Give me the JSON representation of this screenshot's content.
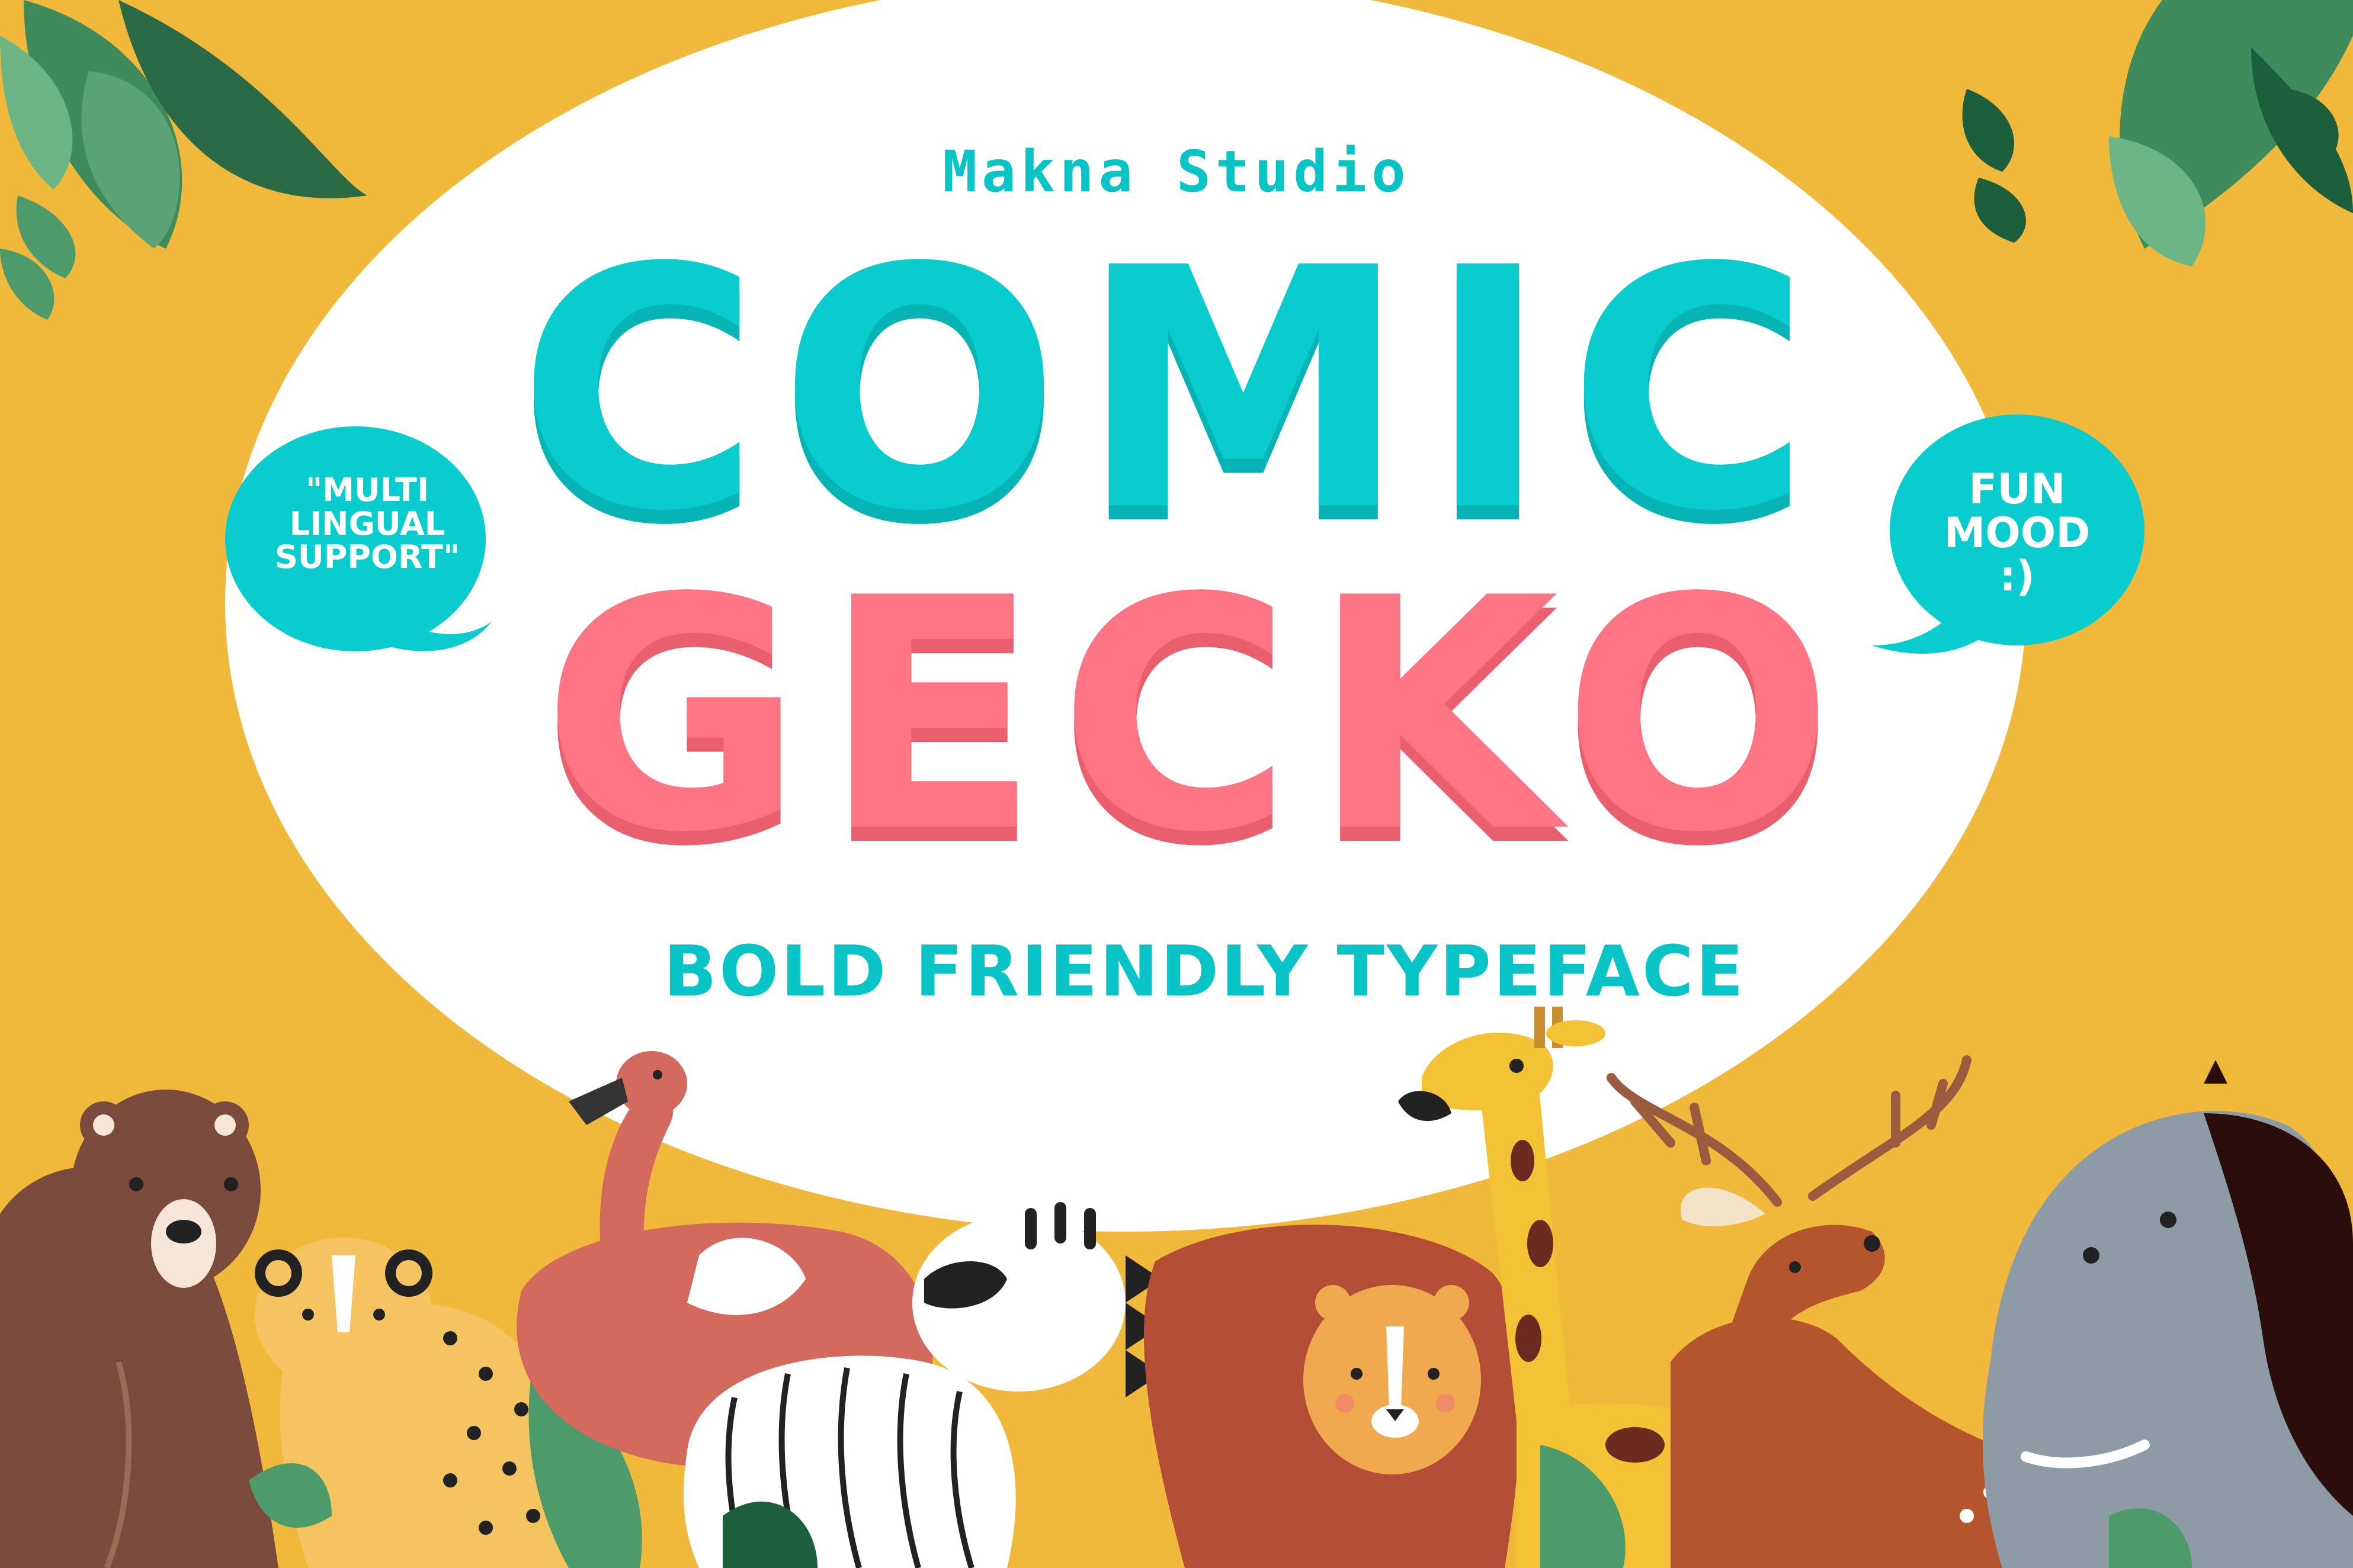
{
  "brand": {
    "studio_name": "Makna Studio"
  },
  "title": {
    "line1": "COMIC",
    "line2": "GECKO"
  },
  "tagline": "BOLD FRIENDLY TYPEFACE",
  "bubbles": {
    "left": {
      "lines": [
        "\"MULTI",
        "LINGUAL",
        "SUPPORT\""
      ]
    },
    "right": {
      "lines": [
        "FUN",
        "MOOD",
        ":)"
      ]
    }
  },
  "colors": {
    "background": "#f1b93b",
    "oval": "#ffffff",
    "teal": "#08cccd",
    "pink": "#fd7485",
    "leaf_green": "#4d9a6b",
    "dark_leaf": "#1d5e3c"
  },
  "illustrations": [
    "bear",
    "cheetah",
    "flamingo",
    "zebra",
    "lion",
    "giraffe",
    "deer",
    "elephant",
    "tropical-leaves"
  ]
}
